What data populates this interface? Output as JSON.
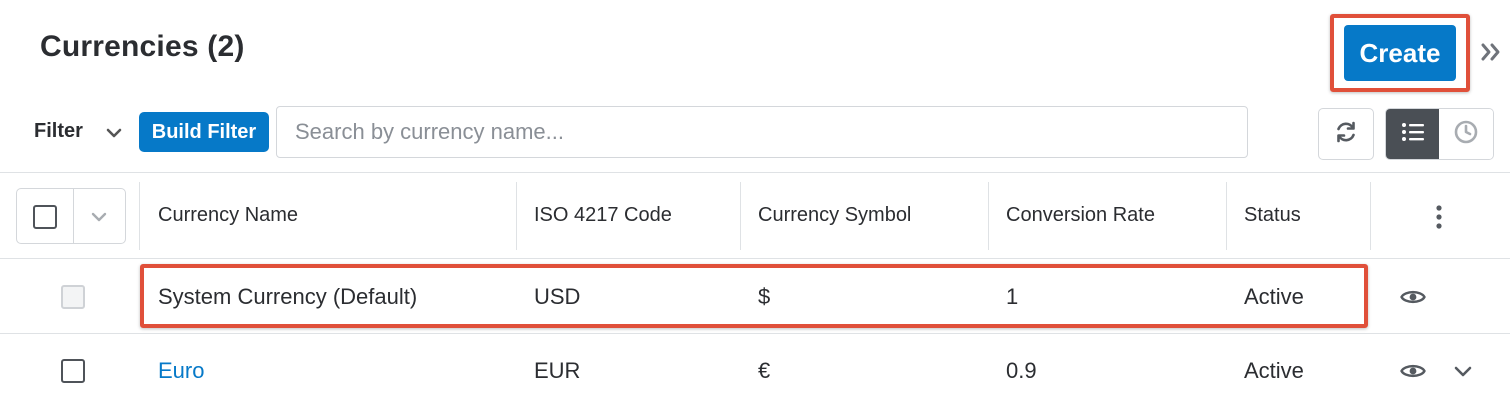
{
  "header": {
    "title": "Currencies (2)",
    "create_label": "Create"
  },
  "filter": {
    "label": "Filter",
    "build_filter_label": "Build Filter",
    "search_placeholder": "Search by currency name...",
    "search_value": ""
  },
  "table": {
    "columns": [
      "Currency Name",
      "ISO 4217 Code",
      "Currency Symbol",
      "Conversion Rate",
      "Status"
    ],
    "rows": [
      {
        "name": "System Currency (Default)",
        "code": "USD",
        "symbol": "$",
        "rate": "1",
        "status": "Active"
      },
      {
        "name": "Euro",
        "code": "EUR",
        "symbol": "€",
        "rate": "0.9",
        "status": "Active"
      }
    ]
  },
  "colors": {
    "accent": "#0679c8",
    "highlight": "#e0503a",
    "text": "#2b2d31"
  },
  "icons": [
    "chevron-double-right-icon",
    "chevron-down-icon",
    "refresh-icon",
    "list-view-icon",
    "clock-icon",
    "kebab-menu-icon",
    "eye-icon"
  ]
}
